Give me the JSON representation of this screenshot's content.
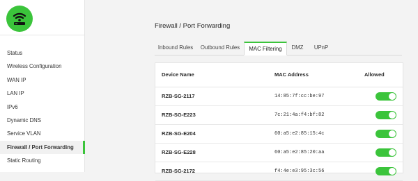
{
  "sidebar": {
    "items": [
      {
        "label": "Status",
        "active": false
      },
      {
        "label": "Wireless Configuration",
        "active": false
      },
      {
        "label": "WAN IP",
        "active": false
      },
      {
        "label": "LAN IP",
        "active": false
      },
      {
        "label": "IPv6",
        "active": false
      },
      {
        "label": "Dynamic DNS",
        "active": false
      },
      {
        "label": "Service VLAN",
        "active": false
      },
      {
        "label": "Firewall / Port Forwarding",
        "active": true
      },
      {
        "label": "Static Routing",
        "active": false
      }
    ]
  },
  "logo": {
    "icon": "wifi-router-icon",
    "color": "#3bc43b"
  },
  "main": {
    "title": "Firewall / Port Forwarding",
    "tabs": [
      {
        "label": "Inbound Rules",
        "active": false
      },
      {
        "label": "Outbound Rules",
        "active": false
      },
      {
        "label": "MAC Filtering",
        "active": true
      },
      {
        "label": "DMZ",
        "active": false
      },
      {
        "label": "UPnP",
        "active": false
      }
    ],
    "table": {
      "headers": {
        "device": "Device Name",
        "mac": "MAC Address",
        "allowed": "Allowed"
      },
      "rows": [
        {
          "device": "RZB-SG-2117",
          "mac": "14:85:7f:cc:be:97",
          "allowed": true
        },
        {
          "device": "RZB-SG-E223",
          "mac": "7c:21:4a:f4:bf:82",
          "allowed": true
        },
        {
          "device": "RZB-SG-E204",
          "mac": "60:a5:e2:85:15:4c",
          "allowed": true
        },
        {
          "device": "RZB-SG-E228",
          "mac": "60:a5:e2:85:20:aa",
          "allowed": true
        },
        {
          "device": "RZB-SG-2172",
          "mac": "f4:4e:e3:95:3c:56",
          "allowed": true
        }
      ]
    }
  },
  "colors": {
    "accent": "#3bc43b",
    "background": "#f3f3f3"
  }
}
